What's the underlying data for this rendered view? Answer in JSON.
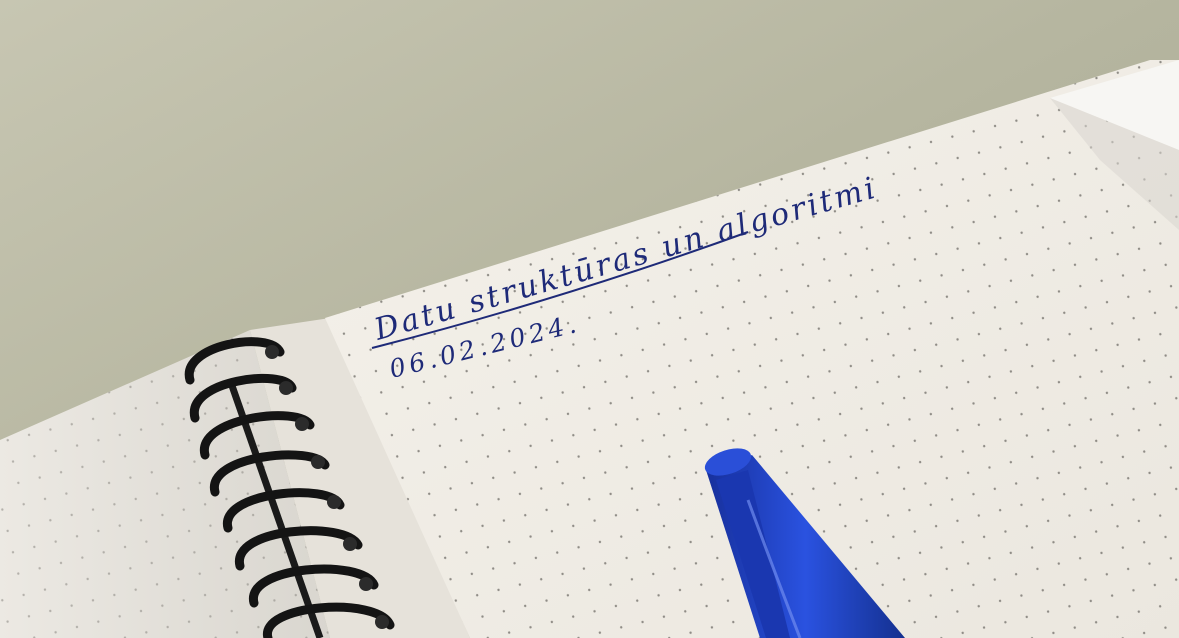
{
  "photo": {
    "subject": "spiral dot-grid notebook with handwriting and a blue pen on a table",
    "colors": {
      "table": "#b9b9a2",
      "paper": "#f3f0ea",
      "ink": "#1e2a78",
      "pen": "#1d3fc4",
      "spiral": "#1a1a1a"
    }
  },
  "notebook": {
    "title_text": "Datu struktūras un algoritmi",
    "date_text": "06.02.2024."
  },
  "icons": {
    "pen": "blue-pen",
    "spiral": "spiral-binding"
  }
}
